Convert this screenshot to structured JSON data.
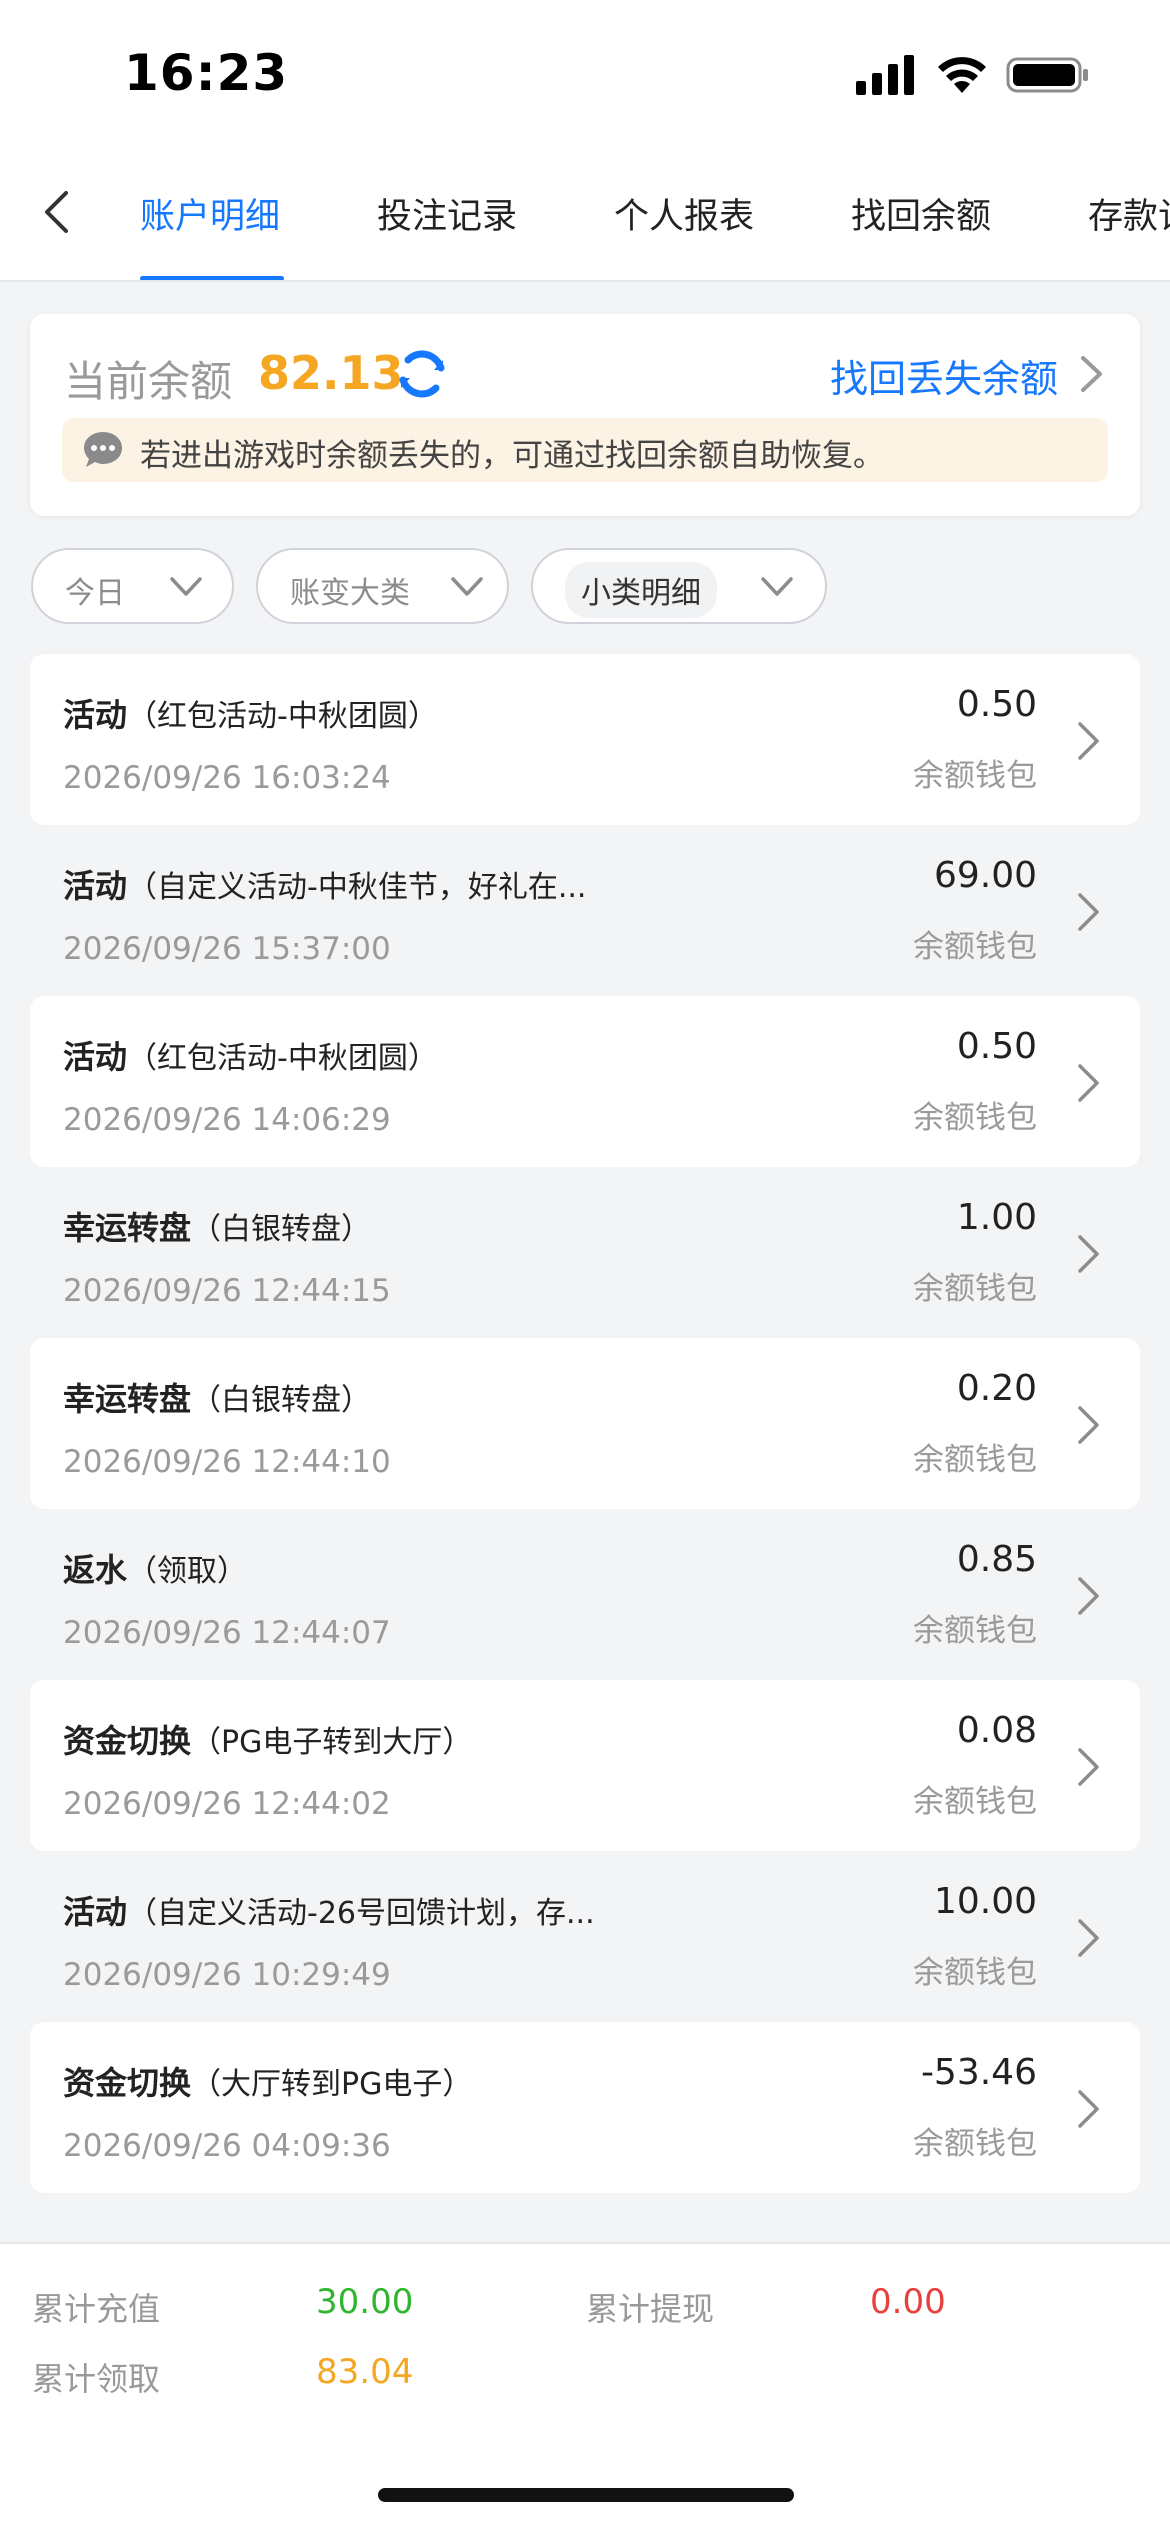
{
  "status_bar": {
    "time": "16:23"
  },
  "tabs": [
    {
      "label": "账户明细",
      "active": true
    },
    {
      "label": "投注记录",
      "active": false
    },
    {
      "label": "个人报表",
      "active": false
    },
    {
      "label": "找回余额",
      "active": false
    },
    {
      "label": "存款记",
      "active": false
    }
  ],
  "balance": {
    "label": "当前余额",
    "value": "82.13",
    "recover_link": "找回丢失余额",
    "notice": "若进出游戏时余额丢失的，可通过找回余额自助恢复。"
  },
  "filters": [
    {
      "label": "今日"
    },
    {
      "label": "账变大类"
    },
    {
      "label": "小类明细"
    }
  ],
  "transactions": [
    {
      "type": "活动",
      "detail": "（红包活动-中秋团圆）",
      "time": "2026/09/26 16:03:24",
      "amount": "0.50",
      "wallet": "余额钱包"
    },
    {
      "type": "活动",
      "detail": "（自定义活动-中秋佳节，好礼在...",
      "time": "2026/09/26 15:37:00",
      "amount": "69.00",
      "wallet": "余额钱包"
    },
    {
      "type": "活动",
      "detail": "（红包活动-中秋团圆）",
      "time": "2026/09/26 14:06:29",
      "amount": "0.50",
      "wallet": "余额钱包"
    },
    {
      "type": "幸运转盘",
      "detail": "（白银转盘）",
      "time": "2026/09/26 12:44:15",
      "amount": "1.00",
      "wallet": "余额钱包"
    },
    {
      "type": "幸运转盘",
      "detail": "（白银转盘）",
      "time": "2026/09/26 12:44:10",
      "amount": "0.20",
      "wallet": "余额钱包"
    },
    {
      "type": "返水",
      "detail": "（领取）",
      "time": "2026/09/26 12:44:07",
      "amount": "0.85",
      "wallet": "余额钱包"
    },
    {
      "type": "资金切换",
      "detail": "（PG电子转到大厅）",
      "time": "2026/09/26 12:44:02",
      "amount": "0.08",
      "wallet": "余额钱包"
    },
    {
      "type": "活动",
      "detail": "（自定义活动-26号回馈计划，存...",
      "time": "2026/09/26 10:29:49",
      "amount": "10.00",
      "wallet": "余额钱包"
    },
    {
      "type": "资金切换",
      "detail": "（大厅转到PG电子）",
      "time": "2026/09/26 04:09:36",
      "amount": "-53.46",
      "wallet": "余额钱包"
    }
  ],
  "summary": {
    "total_deposit_label": "累计充值",
    "total_deposit_value": "30.00",
    "total_withdraw_label": "累计提现",
    "total_withdraw_value": "0.00",
    "total_claim_label": "累计领取",
    "total_claim_value": "83.04"
  },
  "colors": {
    "accent": "#1677ff",
    "balance": "#f5a623",
    "deposit": "#2fb52f",
    "withdraw": "#e8413c",
    "claim": "#f5a623"
  }
}
